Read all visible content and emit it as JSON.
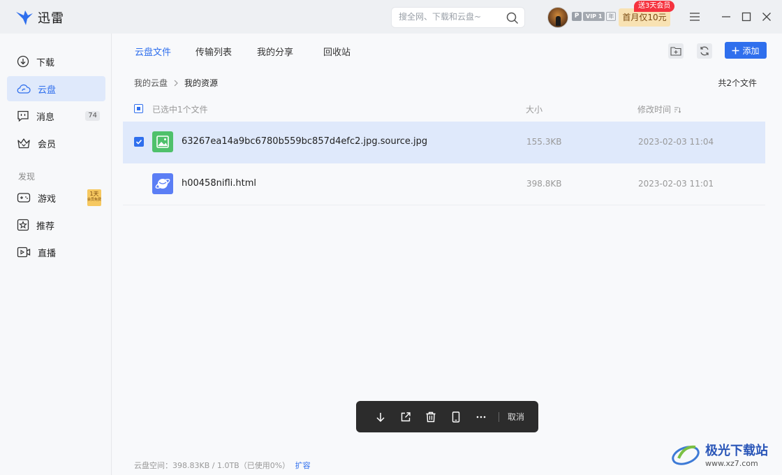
{
  "app": {
    "name": "迅雷"
  },
  "search": {
    "placeholder": "搜全网、下载和云盘~"
  },
  "user": {
    "badge_p": "P",
    "badge_vip": "VIP 1",
    "badge_year": "年"
  },
  "promo": {
    "label": "首月仅10元",
    "tag": "送3天会员"
  },
  "sidebar": {
    "items": [
      {
        "label": "下载",
        "icon": "download-icon"
      },
      {
        "label": "云盘",
        "icon": "cloud-icon"
      },
      {
        "label": "消息",
        "icon": "message-icon",
        "count": "74"
      },
      {
        "label": "会员",
        "icon": "vip-crown-icon"
      }
    ],
    "section_label": "发现",
    "discover": [
      {
        "label": "游戏",
        "icon": "gamepad-icon",
        "badge": "1天",
        "badge_sub": "会员免费"
      },
      {
        "label": "推荐",
        "icon": "star-icon"
      },
      {
        "label": "直播",
        "icon": "live-icon"
      }
    ]
  },
  "tabs": [
    "云盘文件",
    "传输列表",
    "我的分享",
    "回收站"
  ],
  "toolbar": {
    "add_label": "添加"
  },
  "breadcrumb": {
    "root": "我的云盘",
    "current": "我的资源"
  },
  "file_count": "共2个文件",
  "list_header": {
    "selected": "已选中1个文件",
    "size": "大小",
    "modified": "修改时间"
  },
  "files": [
    {
      "name": "63267ea14a9bc6780b559bc857d4efc2.jpg.source.jpg",
      "size": "155.3KB",
      "date": "2023-02-03 11:04",
      "selected": true,
      "type": "image"
    },
    {
      "name": "h00458nifli.html",
      "size": "398.8KB",
      "date": "2023-02-03 11:01",
      "selected": false,
      "type": "html"
    }
  ],
  "action_bar": {
    "cancel": "取消"
  },
  "storage": {
    "text": "云盘空间：398.83KB / 1.0TB（已使用0%）",
    "link": "扩容"
  },
  "watermark": {
    "brand": "极光下载站",
    "url": "www.xz7.com"
  },
  "colors": {
    "accent": "#2f6fed",
    "selected_row": "#dfe9fb",
    "promo": "#f8e2b3",
    "tag": "#f5333f"
  }
}
